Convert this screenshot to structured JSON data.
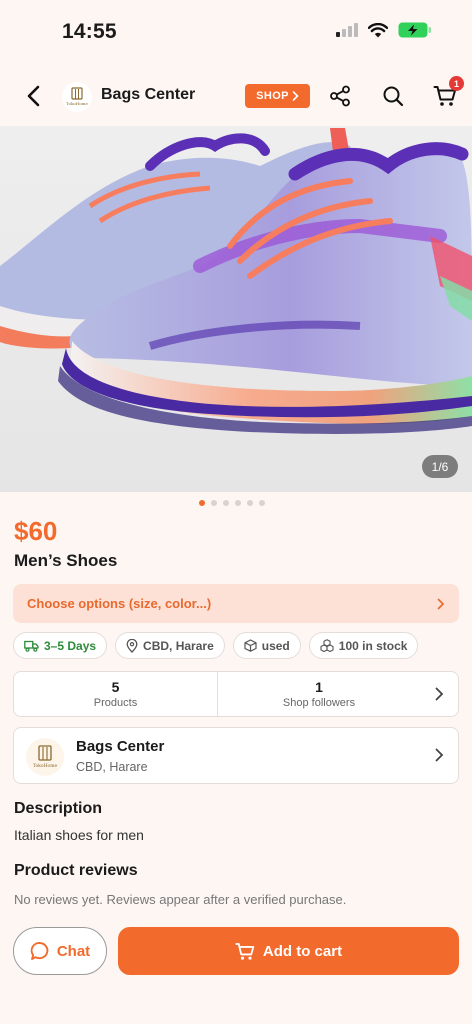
{
  "status_bar": {
    "time": "14:55"
  },
  "header": {
    "shop_name": "Bags Center",
    "shop_button_label": "SHOP",
    "cart_count": "1",
    "logo_text": "TokoHome"
  },
  "gallery": {
    "counter": "1/6",
    "dots_total": 6,
    "dots_active": 1,
    "image": "running-shoes-photo"
  },
  "product": {
    "price": "$60",
    "name": "Men’s Shoes",
    "options_label": "Choose options (size, color...)"
  },
  "tags": [
    {
      "icon": "truck-icon",
      "label": "3–5 Days"
    },
    {
      "icon": "location-pin-icon",
      "label": "CBD, Harare"
    },
    {
      "icon": "box-icon",
      "label": "used"
    },
    {
      "icon": "stock-icon",
      "label": "100 in stock"
    }
  ],
  "stats": [
    {
      "value": "5",
      "label": "Products"
    },
    {
      "value": "1",
      "label": "Shop followers"
    }
  ],
  "shop": {
    "name": "Bags Center",
    "location": "CBD, Harare"
  },
  "description": {
    "title": "Description",
    "text": "Italian shoes for men"
  },
  "reviews": {
    "title": "Product reviews",
    "text": "No reviews yet. Reviews appear after a verified purchase."
  },
  "actions": {
    "chat_label": "Chat",
    "add_to_cart_label": "Add to cart"
  },
  "colors": {
    "accent": "#f26a2c",
    "options_bg": "#fde1d6",
    "badge": "#e53935",
    "delivery_green": "#2e8b3a"
  }
}
